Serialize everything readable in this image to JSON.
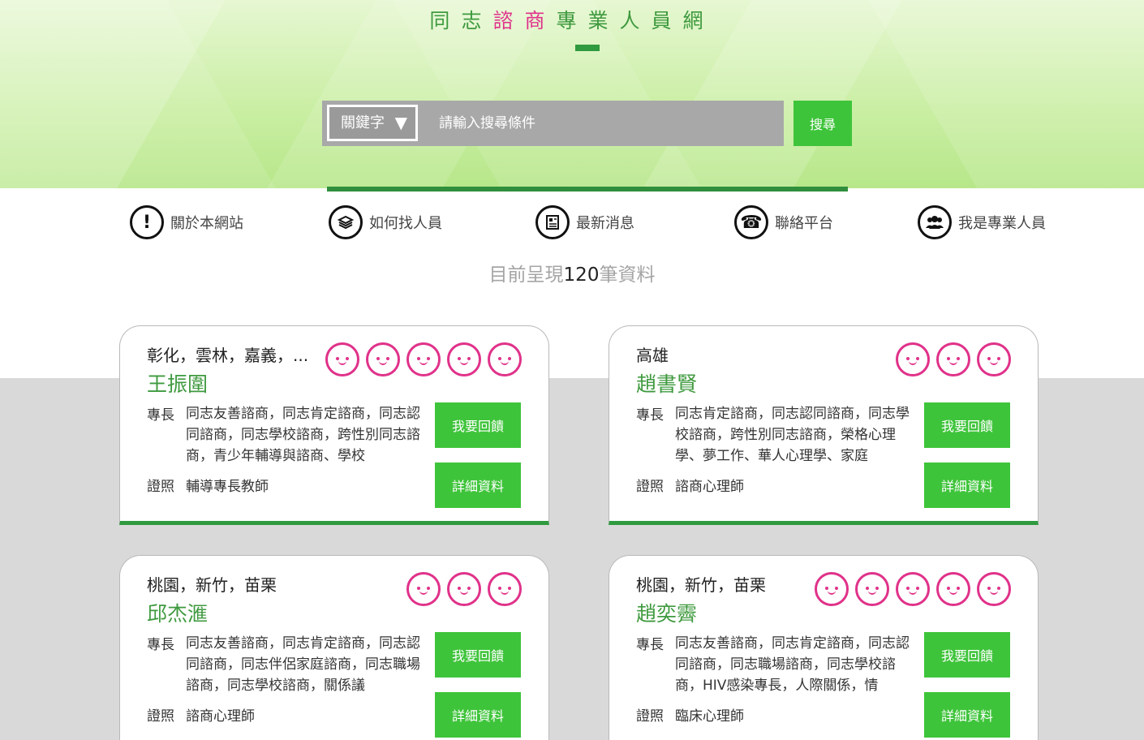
{
  "header": {
    "title_chars": [
      {
        "char": "同",
        "color": "green"
      },
      {
        "char": "志",
        "color": "green"
      },
      {
        "char": "諮",
        "color": "pink"
      },
      {
        "char": "商",
        "color": "pink"
      },
      {
        "char": "專",
        "color": "green"
      },
      {
        "char": "業",
        "color": "green"
      },
      {
        "char": "人",
        "color": "green"
      },
      {
        "char": "員",
        "color": "green"
      },
      {
        "char": "網",
        "color": "green"
      }
    ]
  },
  "search": {
    "select_label": "關鍵字",
    "placeholder": "請輸入搜尋條件",
    "button_label": "搜尋"
  },
  "nav": {
    "items": [
      {
        "label": "關於本網站",
        "icon": "exclamation-icon"
      },
      {
        "label": "如何找人員",
        "icon": "books-icon"
      },
      {
        "label": "最新消息",
        "icon": "newspaper-icon"
      },
      {
        "label": "聯絡平台",
        "icon": "phone-icon"
      },
      {
        "label": "我是專業人員",
        "icon": "group-icon"
      }
    ]
  },
  "results": {
    "prefix": "目前呈現",
    "count": "120",
    "suffix": "筆資料"
  },
  "cards": [
    {
      "area": "彰化，雲林，嘉義，...",
      "name": "王振圍",
      "rating": 5,
      "spec_label": "專長",
      "spec": "同志友善諮商，同志肯定諮商，同志認同諮商，同志學校諮商，跨性別同志諮商，青少年輔導與諮商、學校",
      "cert_label": "證照",
      "cert": "輔導專長教師",
      "feedback_label": "我要回饋",
      "detail_label": "詳細資料"
    },
    {
      "area": "高雄",
      "name": "趙書賢",
      "rating": 3,
      "spec_label": "專長",
      "spec": "同志肯定諮商，同志認同諮商，同志學校諮商，跨性別同志諮商，榮格心理學、夢工作、華人心理學、家庭",
      "cert_label": "證照",
      "cert": "諮商心理師",
      "feedback_label": "我要回饋",
      "detail_label": "詳細資料"
    },
    {
      "area": "桃園，新竹，苗栗",
      "name": "邱杰滙",
      "rating": 3,
      "spec_label": "專長",
      "spec": "同志友善諮商，同志肯定諮商，同志認同諮商，同志伴侶家庭諮商，同志職場諮商，同志學校諮商，關係議",
      "cert_label": "證照",
      "cert": "諮商心理師",
      "feedback_label": "我要回饋",
      "detail_label": "詳細資料"
    },
    {
      "area": "桃園，新竹，苗栗",
      "name": "趙奕霽",
      "rating": 5,
      "spec_label": "專長",
      "spec": "同志友善諮商，同志肯定諮商，同志認同諮商，同志職場諮商，同志學校諮商，HIV感染專長，人際關係，情",
      "cert_label": "證照",
      "cert": "臨床心理師",
      "feedback_label": "我要回饋",
      "detail_label": "詳細資料"
    }
  ],
  "colors": {
    "green": "#3f9a3f",
    "pink": "#e0328a",
    "button_green": "#3ec43a",
    "bar_green": "#2f9a3f"
  }
}
